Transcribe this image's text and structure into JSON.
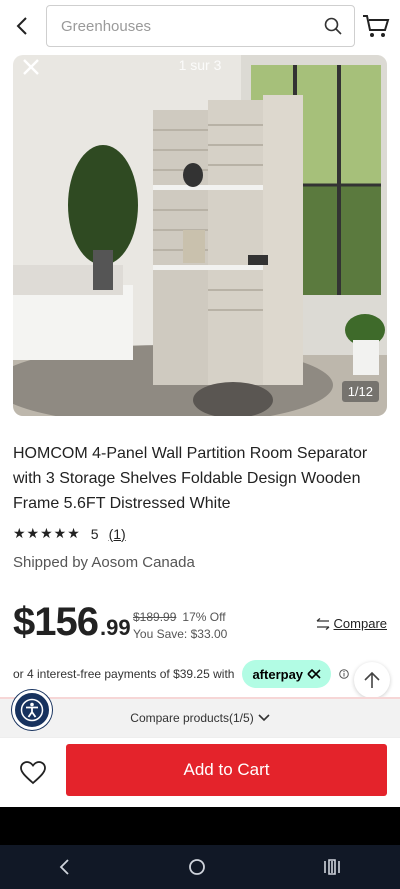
{
  "search": {
    "placeholder": "Greenhouses"
  },
  "gallery": {
    "slide_label": "1 sur 3",
    "image_count": "1/12"
  },
  "product": {
    "title": "HOMCOM 4-Panel Wall Partition Room Separator with 3 Storage Shelves Foldable Design Wooden Frame 5.6FT Distressed White",
    "stars": "★★★★★",
    "rating_value": "5",
    "review_count": "(1)",
    "shipped_by": "Shipped by Aosom Canada"
  },
  "price": {
    "main": "$156",
    "cents": ".99",
    "original": "$189.99",
    "discount": "17% Off",
    "savings": "You Save: $33.00",
    "compare_label": "Compare"
  },
  "installments": {
    "text": "or 4 interest-free payments of $39.25 with",
    "provider": "afterpay"
  },
  "compare_strip": {
    "label": "Compare products(1/5)"
  },
  "actions": {
    "add_to_cart": "Add to Cart"
  },
  "colors": {
    "accent": "#e4232b",
    "afterpay": "#b2fce4",
    "nav_bg": "#111826",
    "access_btn": "#17325e"
  },
  "icons": [
    "back-arrow-icon",
    "search-icon",
    "cart-icon",
    "close-icon",
    "compare-arrows-icon",
    "info-icon",
    "arrow-up-icon",
    "accessibility-icon",
    "heart-icon",
    "chevron-down-icon",
    "nav-back-icon",
    "nav-home-icon",
    "nav-recents-icon"
  ]
}
